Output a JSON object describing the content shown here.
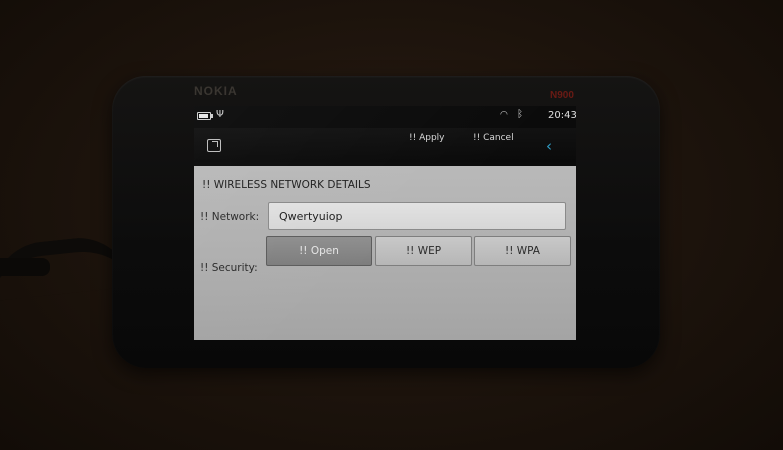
{
  "device": {
    "brand": "NOKIA",
    "model": "N900"
  },
  "statusbar": {
    "battery_level": 0.85,
    "time": "20:43",
    "icons": [
      "battery-icon",
      "antenna-icon",
      "wifi-icon",
      "bluetooth-icon"
    ]
  },
  "toolbar": {
    "apply_label": "!! Apply",
    "cancel_label": "!! Cancel",
    "back_glyph": "‹",
    "task_icon": "task-switcher-icon",
    "back_color": "#2f9fc9"
  },
  "form": {
    "title": "!! WIRELESS NETWORK DETAILS",
    "network_label": "!! Network:",
    "network_value": "Qwertyuiop",
    "security_label": "!! Security:",
    "security_options": [
      {
        "label": "!! Open",
        "selected": true
      },
      {
        "label": "!! WEP",
        "selected": false
      },
      {
        "label": "!! WPA",
        "selected": false
      }
    ]
  },
  "colors": {
    "content_bg": "#b4b4b4",
    "selected_segment": "#878787"
  }
}
